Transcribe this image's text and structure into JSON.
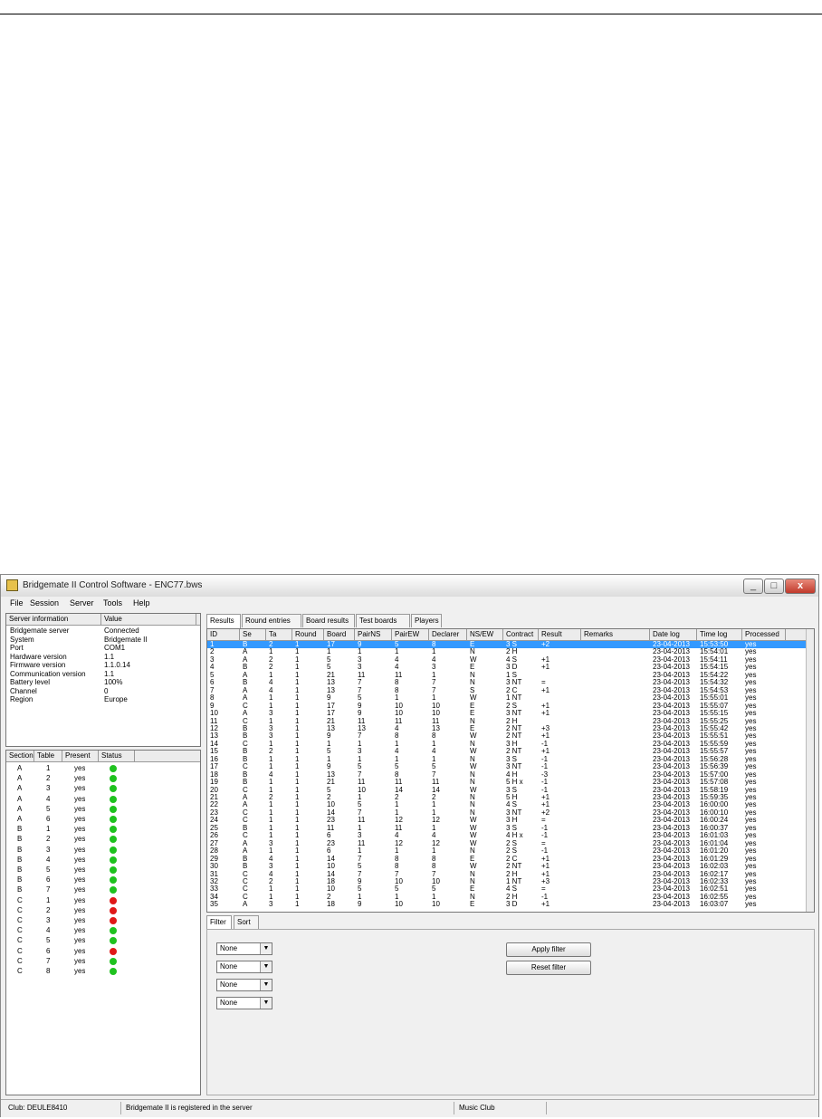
{
  "window": {
    "title": "Bridgemate II Control Software - ENC77.bws",
    "minimize": "_",
    "maximize": "□",
    "close": "x"
  },
  "menu": [
    "File",
    "Session",
    "Server",
    "Tools",
    "Help"
  ],
  "server_info": {
    "headers": [
      "Server information",
      "Value"
    ],
    "rows": [
      [
        "Bridgemate server",
        "Connected"
      ],
      [
        "System",
        "Bridgemate II"
      ],
      [
        "Port",
        "COM1"
      ],
      [
        "Hardware version",
        "1.1"
      ],
      [
        "Firmware version",
        "1.1.0.14"
      ],
      [
        "Communication version",
        "1.1"
      ],
      [
        "Battery level",
        "100%"
      ],
      [
        "Channel",
        "0"
      ],
      [
        "Region",
        "Europe"
      ]
    ]
  },
  "tables_pane": {
    "headers": [
      "Section",
      "Table",
      "Present",
      "Status"
    ],
    "rows": [
      [
        "A",
        "1",
        "yes",
        "green"
      ],
      [
        "A",
        "2",
        "yes",
        "green"
      ],
      [
        "A",
        "3",
        "yes",
        "green"
      ],
      [
        "A",
        "4",
        "yes",
        "green"
      ],
      [
        "A",
        "5",
        "yes",
        "green"
      ],
      [
        "A",
        "6",
        "yes",
        "green"
      ],
      [
        "B",
        "1",
        "yes",
        "green"
      ],
      [
        "B",
        "2",
        "yes",
        "green"
      ],
      [
        "B",
        "3",
        "yes",
        "green"
      ],
      [
        "B",
        "4",
        "yes",
        "green"
      ],
      [
        "B",
        "5",
        "yes",
        "green"
      ],
      [
        "B",
        "6",
        "yes",
        "green"
      ],
      [
        "B",
        "7",
        "yes",
        "green"
      ],
      [
        "C",
        "1",
        "yes",
        "red"
      ],
      [
        "C",
        "2",
        "yes",
        "red"
      ],
      [
        "C",
        "3",
        "yes",
        "red"
      ],
      [
        "C",
        "4",
        "yes",
        "green"
      ],
      [
        "C",
        "5",
        "yes",
        "green"
      ],
      [
        "C",
        "6",
        "yes",
        "red"
      ],
      [
        "C",
        "7",
        "yes",
        "green"
      ],
      [
        "C",
        "8",
        "yes",
        "green"
      ]
    ],
    "colors": {
      "green": "#1fc21f",
      "red": "#e01818"
    }
  },
  "tabs": [
    "Results",
    "Round entries",
    "Board results",
    "Test boards",
    "Players"
  ],
  "results": {
    "headers": [
      "ID",
      "Se",
      "Ta",
      "Round",
      "Board",
      "PairNS",
      "PairEW",
      "Declarer",
      "NS/EW",
      "Contract",
      "Result",
      "Remarks",
      "Date log",
      "Time log",
      "Processed"
    ],
    "rows": [
      [
        "1",
        "B",
        "2",
        "1",
        "17",
        "9",
        "5",
        "8",
        "E",
        "3 S",
        "+2",
        "",
        "23-04-2013",
        "15:53:50",
        "yes"
      ],
      [
        "2",
        "A",
        "1",
        "1",
        "1",
        "1",
        "1",
        "1",
        "N",
        "2 H",
        "",
        "",
        "23-04-2013",
        "15:54:01",
        "yes"
      ],
      [
        "3",
        "A",
        "2",
        "1",
        "5",
        "3",
        "4",
        "4",
        "W",
        "4 S",
        "+1",
        "",
        "23-04-2013",
        "15:54:11",
        "yes"
      ],
      [
        "4",
        "B",
        "2",
        "1",
        "5",
        "3",
        "4",
        "3",
        "E",
        "3 D",
        "+1",
        "",
        "23-04-2013",
        "15:54:15",
        "yes"
      ],
      [
        "5",
        "A",
        "1",
        "1",
        "21",
        "11",
        "11",
        "1",
        "N",
        "1 S",
        "",
        "",
        "23-04-2013",
        "15:54:22",
        "yes"
      ],
      [
        "6",
        "B",
        "4",
        "1",
        "13",
        "7",
        "8",
        "7",
        "N",
        "3 NT",
        "=",
        "",
        "23-04-2013",
        "15:54:32",
        "yes"
      ],
      [
        "7",
        "A",
        "4",
        "1",
        "13",
        "7",
        "8",
        "7",
        "S",
        "2 C",
        "+1",
        "",
        "23-04-2013",
        "15:54:53",
        "yes"
      ],
      [
        "8",
        "A",
        "1",
        "1",
        "9",
        "5",
        "1",
        "1",
        "W",
        "1 NT",
        "",
        "",
        "23-04-2013",
        "15:55:01",
        "yes"
      ],
      [
        "9",
        "C",
        "1",
        "1",
        "17",
        "9",
        "10",
        "10",
        "E",
        "2 S",
        "+1",
        "",
        "23-04-2013",
        "15:55:07",
        "yes"
      ],
      [
        "10",
        "A",
        "3",
        "1",
        "17",
        "9",
        "10",
        "10",
        "E",
        "3 NT",
        "+1",
        "",
        "23-04-2013",
        "15:55:15",
        "yes"
      ],
      [
        "11",
        "C",
        "1",
        "1",
        "21",
        "11",
        "11",
        "11",
        "N",
        "2 H",
        "",
        "",
        "23-04-2013",
        "15:55:25",
        "yes"
      ],
      [
        "12",
        "B",
        "3",
        "1",
        "13",
        "13",
        "4",
        "13",
        "E",
        "2 NT",
        "+3",
        "",
        "23-04-2013",
        "15:55:42",
        "yes"
      ],
      [
        "13",
        "B",
        "3",
        "1",
        "9",
        "7",
        "8",
        "8",
        "W",
        "2 NT",
        "+1",
        "",
        "23-04-2013",
        "15:55:51",
        "yes"
      ],
      [
        "14",
        "C",
        "1",
        "1",
        "1",
        "1",
        "1",
        "1",
        "N",
        "3 H",
        "-1",
        "",
        "23-04-2013",
        "15:55:59",
        "yes"
      ],
      [
        "15",
        "B",
        "2",
        "1",
        "5",
        "3",
        "4",
        "4",
        "W",
        "2 NT",
        "+1",
        "",
        "23-04-2013",
        "15:55:57",
        "yes"
      ],
      [
        "16",
        "B",
        "1",
        "1",
        "1",
        "1",
        "1",
        "1",
        "N",
        "3 S",
        "-1",
        "",
        "23-04-2013",
        "15:56:28",
        "yes"
      ],
      [
        "17",
        "C",
        "1",
        "1",
        "9",
        "5",
        "5",
        "5",
        "W",
        "3 NT",
        "-1",
        "",
        "23-04-2013",
        "15:56:39",
        "yes"
      ],
      [
        "18",
        "B",
        "4",
        "1",
        "13",
        "7",
        "8",
        "7",
        "N",
        "4 H",
        "-3",
        "",
        "23-04-2013",
        "15:57:00",
        "yes"
      ],
      [
        "19",
        "B",
        "1",
        "1",
        "21",
        "11",
        "11",
        "11",
        "N",
        "5 H x",
        "-1",
        "",
        "23-04-2013",
        "15:57:08",
        "yes"
      ],
      [
        "20",
        "C",
        "1",
        "1",
        "5",
        "10",
        "14",
        "14",
        "W",
        "3 S",
        "-1",
        "",
        "23-04-2013",
        "15:58:19",
        "yes"
      ],
      [
        "21",
        "A",
        "2",
        "1",
        "2",
        "1",
        "2",
        "2",
        "N",
        "5 H",
        "+1",
        "",
        "23-04-2013",
        "15:59:35",
        "yes"
      ],
      [
        "22",
        "A",
        "1",
        "1",
        "10",
        "5",
        "1",
        "1",
        "N",
        "4 S",
        "+1",
        "",
        "23-04-2013",
        "16:00:00",
        "yes"
      ],
      [
        "23",
        "C",
        "1",
        "1",
        "14",
        "7",
        "1",
        "1",
        "N",
        "3 NT",
        "+2",
        "",
        "23-04-2013",
        "16:00:10",
        "yes"
      ],
      [
        "24",
        "C",
        "1",
        "1",
        "23",
        "11",
        "12",
        "12",
        "W",
        "3 H",
        "=",
        "",
        "23-04-2013",
        "16:00:24",
        "yes"
      ],
      [
        "25",
        "B",
        "1",
        "1",
        "11",
        "1",
        "11",
        "1",
        "W",
        "3 S",
        "-1",
        "",
        "23-04-2013",
        "16:00:37",
        "yes"
      ],
      [
        "26",
        "C",
        "1",
        "1",
        "6",
        "3",
        "4",
        "4",
        "W",
        "4 H x",
        "-1",
        "",
        "23-04-2013",
        "16:01:03",
        "yes"
      ],
      [
        "27",
        "A",
        "3",
        "1",
        "23",
        "11",
        "12",
        "12",
        "W",
        "2 S",
        "=",
        "",
        "23-04-2013",
        "16:01:04",
        "yes"
      ],
      [
        "28",
        "A",
        "1",
        "1",
        "6",
        "1",
        "1",
        "1",
        "N",
        "2 S",
        "-1",
        "",
        "23-04-2013",
        "16:01:20",
        "yes"
      ],
      [
        "29",
        "B",
        "4",
        "1",
        "14",
        "7",
        "8",
        "8",
        "E",
        "2 C",
        "+1",
        "",
        "23-04-2013",
        "16:01:29",
        "yes"
      ],
      [
        "30",
        "B",
        "3",
        "1",
        "10",
        "5",
        "8",
        "8",
        "W",
        "2 NT",
        "+1",
        "",
        "23-04-2013",
        "16:02:03",
        "yes"
      ],
      [
        "31",
        "C",
        "4",
        "1",
        "14",
        "7",
        "7",
        "7",
        "N",
        "2 H",
        "+1",
        "",
        "23-04-2013",
        "16:02:17",
        "yes"
      ],
      [
        "32",
        "C",
        "2",
        "1",
        "18",
        "9",
        "10",
        "10",
        "N",
        "1 NT",
        "+3",
        "",
        "23-04-2013",
        "16:02:33",
        "yes"
      ],
      [
        "33",
        "C",
        "1",
        "1",
        "10",
        "5",
        "5",
        "5",
        "E",
        "4 S",
        "=",
        "",
        "23-04-2013",
        "16:02:51",
        "yes"
      ],
      [
        "34",
        "C",
        "1",
        "1",
        "2",
        "1",
        "1",
        "1",
        "N",
        "2 H",
        "-1",
        "",
        "23-04-2013",
        "16:02:55",
        "yes"
      ],
      [
        "35",
        "A",
        "3",
        "1",
        "18",
        "9",
        "10",
        "10",
        "E",
        "3 D",
        "+1",
        "",
        "23-04-2013",
        "16:03:07",
        "yes"
      ]
    ]
  },
  "bottom_tabs": [
    "Filter",
    "Sort"
  ],
  "filters": [
    "None",
    "None",
    "None",
    "None"
  ],
  "buttons": {
    "apply": "Apply filter",
    "reset": "Reset filter"
  },
  "status": [
    "Club: DEULE8410",
    "Bridgemate II is registered in the server",
    "Music Club"
  ],
  "selection_color": "#3399ff"
}
